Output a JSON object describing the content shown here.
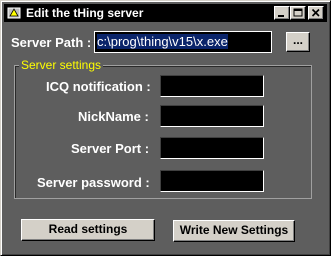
{
  "window": {
    "title": "Edit the tHing server",
    "icon": "thing-app-icon"
  },
  "titlebar_buttons": {
    "minimize": "minimize-icon",
    "maximize": "maximize-icon",
    "close": "close-icon"
  },
  "server_path": {
    "label": "Server  Path :",
    "value": "c:\\prog\\thing\\v15\\x.exe",
    "browse_label": "..."
  },
  "settings_group": {
    "title": "Server settings",
    "fields": [
      {
        "label": "ICQ notification :",
        "value": ""
      },
      {
        "label": "NickName :",
        "value": ""
      },
      {
        "label": "Server Port :",
        "value": ""
      },
      {
        "label": "Server password :",
        "value": ""
      }
    ]
  },
  "actions": {
    "read_label": "Read settings",
    "write_label": "Write New Settings"
  },
  "colors": {
    "window_bg": "#5e5e5e",
    "titlebar_bg": "#000000",
    "group_title": "#ffff00",
    "selection": "#0a246a"
  }
}
